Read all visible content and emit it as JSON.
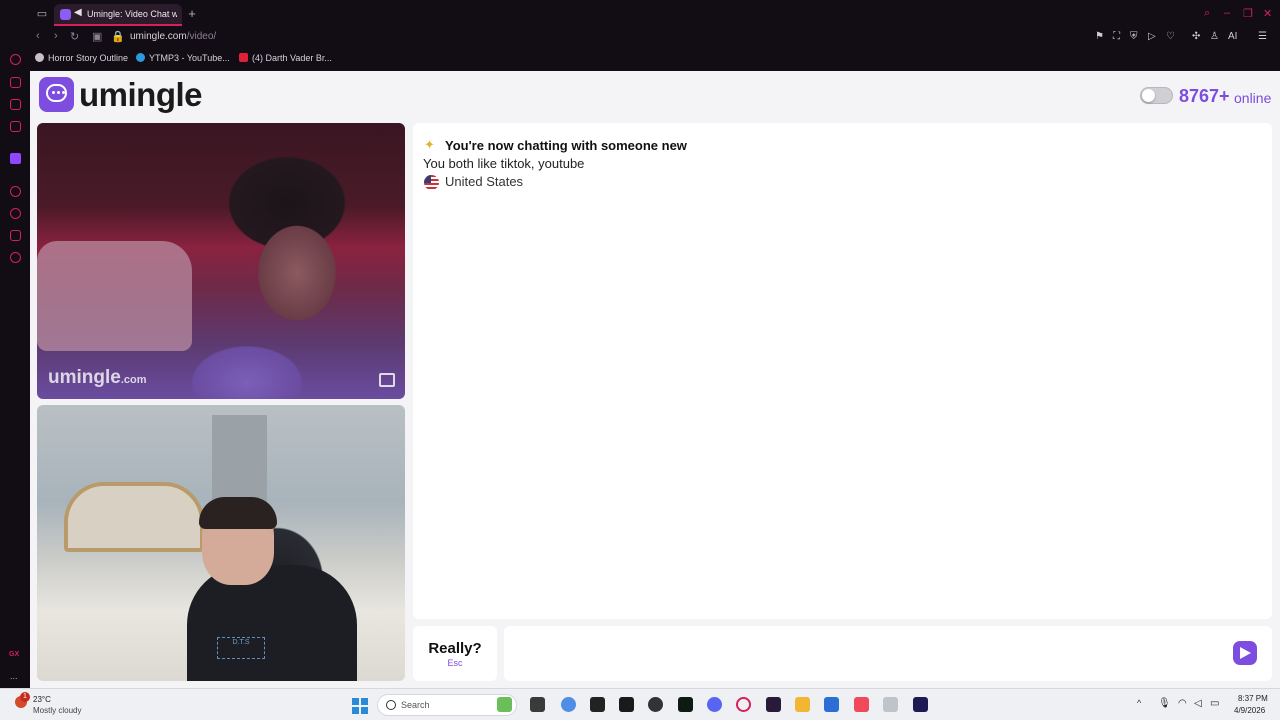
{
  "browser": {
    "tab_title": "Umingle: Video Chat w",
    "url_host": "umingle.com",
    "url_path": "/video/",
    "ai_label": "AI",
    "bookmarks": [
      "Horror Story Outline",
      "YTMP3 - YouTube...",
      "(4) Darth Vader Br..."
    ]
  },
  "sidebar": {
    "gx_label": "GX",
    "more_label": "..."
  },
  "header": {
    "brand": "umingle",
    "online_count": "8767+",
    "online_label": "online",
    "toggle_on": false
  },
  "remote_video": {
    "watermark_name": "umingle",
    "watermark_suffix": ".com"
  },
  "local_video": {
    "shirt_text": "D.T.S"
  },
  "chat": {
    "status": "You're now chatting with someone new",
    "interests": "You both like tiktok, youtube",
    "country": "United States"
  },
  "controls": {
    "skip_label": "Really?",
    "skip_hint": "Esc",
    "message_placeholder": ""
  },
  "taskbar": {
    "weather_badge": "1",
    "weather_temp": "23°C",
    "weather_desc": "Mostly cloudy",
    "search_label": "Search",
    "time": "8:37 PM",
    "date": "4/9/2026"
  },
  "colors": {
    "accent": "#7c4dde",
    "opera_red": "#d6205a"
  }
}
